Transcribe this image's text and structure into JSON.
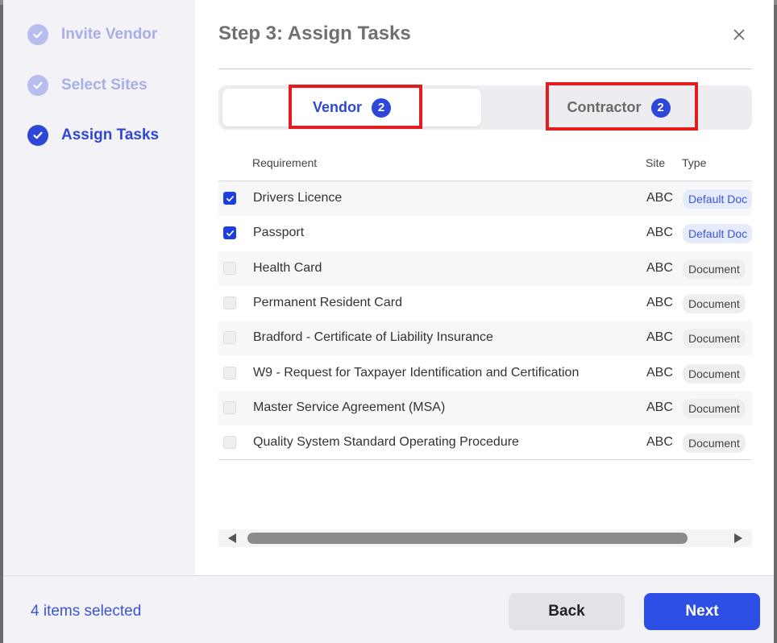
{
  "steps": [
    {
      "label": "Invite Vendor",
      "state": "done"
    },
    {
      "label": "Select Sites",
      "state": "done"
    },
    {
      "label": "Assign Tasks",
      "state": "active"
    }
  ],
  "title": "Step 3: Assign Tasks",
  "close_icon": "close-icon",
  "tabs": [
    {
      "label": "Vendor",
      "count": "2",
      "active": true
    },
    {
      "label": "Contractor",
      "count": "2",
      "active": false
    }
  ],
  "table": {
    "headers": {
      "requirement": "Requirement",
      "site": "Site",
      "type": "Type"
    },
    "rows": [
      {
        "checked": true,
        "requirement": "Drivers Licence",
        "site": "ABC",
        "type": "Default Doc"
      },
      {
        "checked": true,
        "requirement": "Passport",
        "site": "ABC",
        "type": "Default Doc"
      },
      {
        "checked": false,
        "requirement": "Health Card",
        "site": "ABC",
        "type": "Document"
      },
      {
        "checked": false,
        "requirement": "Permanent Resident Card",
        "site": "ABC",
        "type": "Document"
      },
      {
        "checked": false,
        "requirement": "Bradford - Certificate of Liability Insurance",
        "site": "ABC",
        "type": "Document"
      },
      {
        "checked": false,
        "requirement": "W9 - Request for Taxpayer Identification and Certification",
        "site": "ABC",
        "type": "Document"
      },
      {
        "checked": false,
        "requirement": "Master Service Agreement (MSA)",
        "site": "ABC",
        "type": "Document"
      },
      {
        "checked": false,
        "requirement": "Quality System Standard Operating Procedure",
        "site": "ABC",
        "type": "Document"
      }
    ]
  },
  "footer": {
    "selected_text": "4 items selected",
    "back_label": "Back",
    "next_label": "Next"
  },
  "colors": {
    "accent": "#2e47d6",
    "highlight": "#e11d1d"
  }
}
